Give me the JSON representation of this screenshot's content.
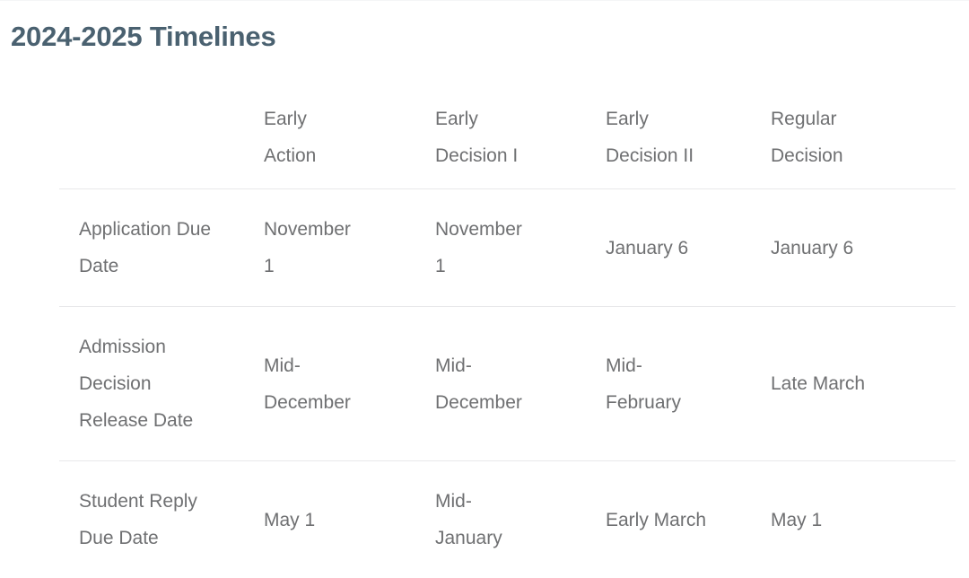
{
  "page": {
    "title": "2024-2025 Timelines",
    "title_color": "#4a6170",
    "text_color": "#6f7072",
    "divider_color": "#e8e8ea",
    "background": "#ffffff"
  },
  "table": {
    "corner_header": "",
    "columns": [
      {
        "label": ""
      },
      {
        "label": "Early Action"
      },
      {
        "label": "Early Decision I"
      },
      {
        "label": "Early Decision II"
      },
      {
        "label": "Regular Decision"
      }
    ],
    "rows": [
      {
        "header": "Application Due Date",
        "cells": [
          "November 1",
          "November 1",
          "January 6",
          "January 6"
        ]
      },
      {
        "header": "Admission Decision Release Date",
        "cells": [
          "Mid-December",
          "Mid-December",
          "Mid-February",
          "Late March"
        ]
      },
      {
        "header": "Student Reply Due Date",
        "cells": [
          "May 1",
          "Mid-January",
          "Early March",
          "May 1"
        ]
      }
    ]
  }
}
